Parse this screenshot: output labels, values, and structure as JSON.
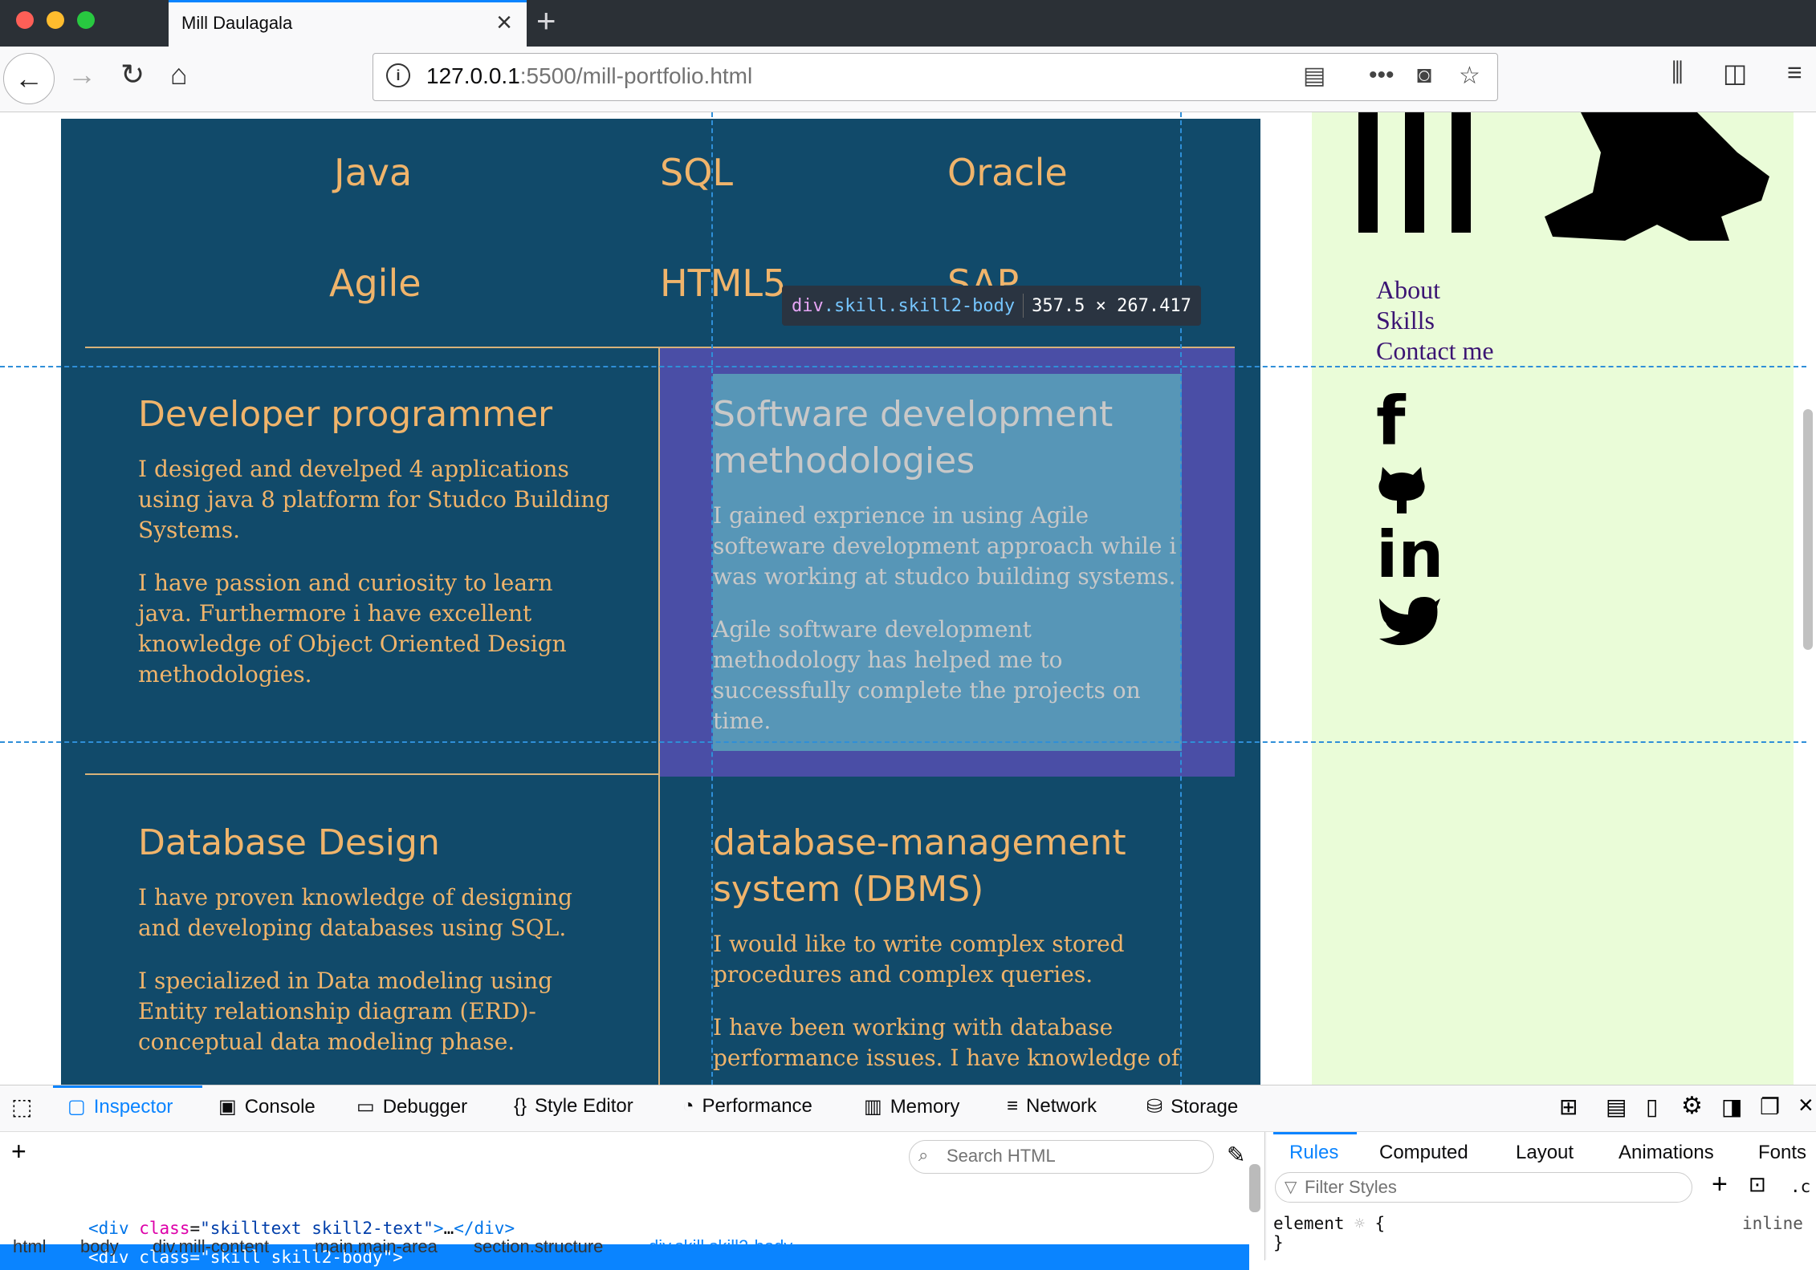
{
  "browser": {
    "tab_title": "Mill Daulagala",
    "url_host": "127.0.0.1",
    "url_rest": ":5500/mill-portfolio.html",
    "colors": {
      "traffic_close": "#fe5f57",
      "traffic_min": "#febc2e",
      "traffic_max": "#28c840"
    }
  },
  "page": {
    "skills_row1": [
      "Java",
      "SQL",
      "Oracle"
    ],
    "skills_row2": [
      "Agile",
      "HTML5",
      "SAP"
    ],
    "cards": [
      {
        "title": "Developer programmer",
        "paragraphs": [
          "I desiged and develped 4 applications using java 8 platform for Studco Building Systems.",
          "I have passion and curiosity to learn java. Furthermore i have excellent knowledge of Object Oriented Design methodologies."
        ]
      },
      {
        "title": "Software development methodologies",
        "paragraphs": [
          "I gained exprience in using Agile softeware development approach while i was working at studco building systems.",
          "Agile software development methodology has helped me to successfully complete the projects on time."
        ]
      },
      {
        "title": "Database Design",
        "paragraphs": [
          "I have proven knowledge of designing and developing databases using SQL.",
          "I specialized in Data modeling using Entity relationship diagram (ERD)- conceptual data modeling phase."
        ]
      },
      {
        "title": "database-management system (DBMS)",
        "paragraphs": [
          "I would like to write complex stored procedures and complex queries.",
          "I have been working with database performance issues. I have knowledge of"
        ]
      }
    ],
    "tooltip": {
      "tag": "div",
      "classes": ".skill.skill2-body",
      "size": "357.5 × 267.417"
    },
    "sidebar_nav": [
      "About",
      "Skills",
      "Contact me"
    ],
    "social_icons": [
      "facebook-icon",
      "github-icon",
      "linkedin-icon",
      "twitter-icon"
    ],
    "colors": {
      "main_bg": "#114a6a",
      "accent": "#f0b46b",
      "sidebar_bg": "#eafcd8",
      "link": "#3b1473"
    }
  },
  "devtools": {
    "tabs": [
      "Inspector",
      "Console",
      "Debugger",
      "Style Editor",
      "Performance",
      "Memory",
      "Network",
      "Storage"
    ],
    "search_placeholder": "Search HTML",
    "markup_line1_tag": "div",
    "markup_line1_attr": "class",
    "markup_line1_val": "\"skilltext skill2-text\"",
    "markup_line2": "<div class=\"skill skill2-body\">",
    "breadcrumbs": [
      "html",
      "body",
      "div.mill-content",
      "main.main-area",
      "section.structure",
      "div.skill.skill2-body"
    ],
    "rules_tabs": [
      "Rules",
      "Computed",
      "Layout",
      "Animations",
      "Fonts"
    ],
    "filter_placeholder": "Filter Styles",
    "rule_selector": "element",
    "rule_open": "{",
    "rule_close": "}",
    "rule_source": "inline"
  }
}
